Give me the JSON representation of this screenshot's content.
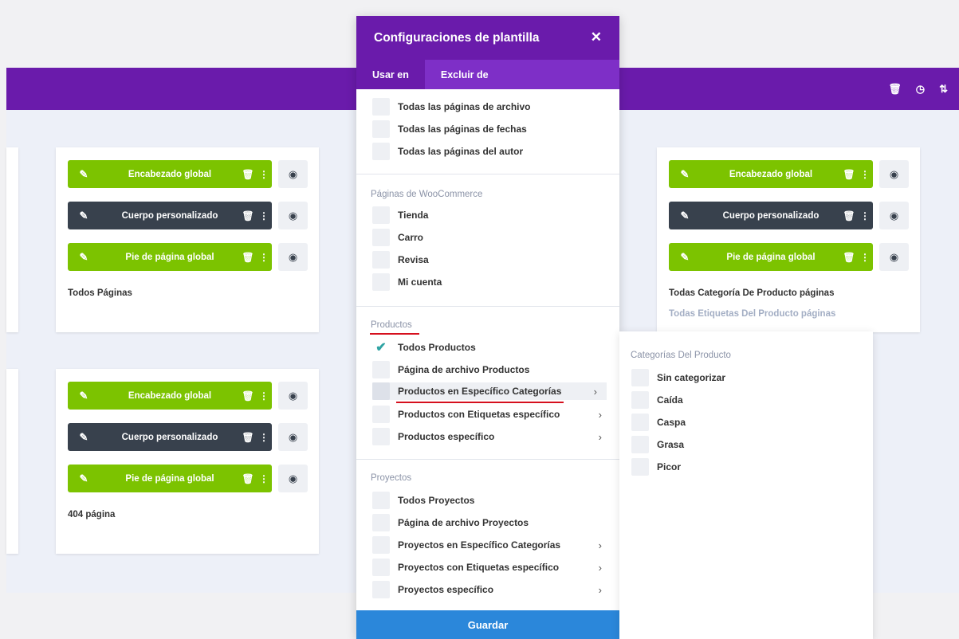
{
  "toolbar_icons": [
    {
      "name": "trash-icon",
      "glyph": "🗑"
    },
    {
      "name": "history-icon",
      "glyph": "◷"
    },
    {
      "name": "sort-icon",
      "glyph": "⇅"
    }
  ],
  "cards": {
    "c1": {
      "rows": [
        {
          "label": "Encabezado global"
        },
        {
          "label": "Cuerpo personalizado"
        },
        {
          "label": "Pie de página global"
        }
      ],
      "title": "Todos Páginas"
    },
    "c2": {
      "rows": [
        {
          "label": "Encabezado global"
        },
        {
          "label": "Cuerpo personalizado"
        },
        {
          "label": "Pie de página global"
        }
      ],
      "title": "Todas Categoría De Producto páginas",
      "subtitle": "Todas Etiquetas Del Producto páginas"
    },
    "c3": {
      "rows": [
        {
          "label": "Encabezado global"
        },
        {
          "label": "Cuerpo personalizado"
        },
        {
          "label": "Pie de página global"
        }
      ],
      "title": "404 página"
    }
  },
  "modal": {
    "title": "Configuraciones de plantilla",
    "close": "✕",
    "tabs": [
      "Usar en",
      "Excluir de"
    ],
    "archive_options": [
      "Todas las páginas de archivo",
      "Todas las páginas de fechas",
      "Todas las páginas del autor"
    ],
    "woo": {
      "title": "Páginas de WooCommerce",
      "options": [
        "Tienda",
        "Carro",
        "Revisa",
        "Mi cuenta"
      ]
    },
    "productos": {
      "title": "Productos",
      "options": [
        "Todos Productos",
        "Página de archivo Productos",
        "Productos en Específico Categorías",
        "Productos con Etiquetas específico",
        "Productos específico"
      ]
    },
    "proyectos": {
      "title": "Proyectos",
      "options": [
        "Todos Proyectos",
        "Página de archivo Proyectos",
        "Proyectos en Específico Categorías",
        "Proyectos con Etiquetas específico",
        "Proyectos específico"
      ]
    },
    "save": "Guardar"
  },
  "submenu": {
    "title": "Categorías Del Producto",
    "options": [
      "Sin categorizar",
      "Caída",
      "Caspa",
      "Grasa",
      "Picor"
    ]
  },
  "colors": {
    "purple": "#6a1bab",
    "purple_light": "#7e2fc7",
    "green": "#7cc300",
    "dark": "#38414d",
    "blue": "#2b87da",
    "teal_check": "#2ea3a3",
    "red_underline": "#d6101e"
  }
}
